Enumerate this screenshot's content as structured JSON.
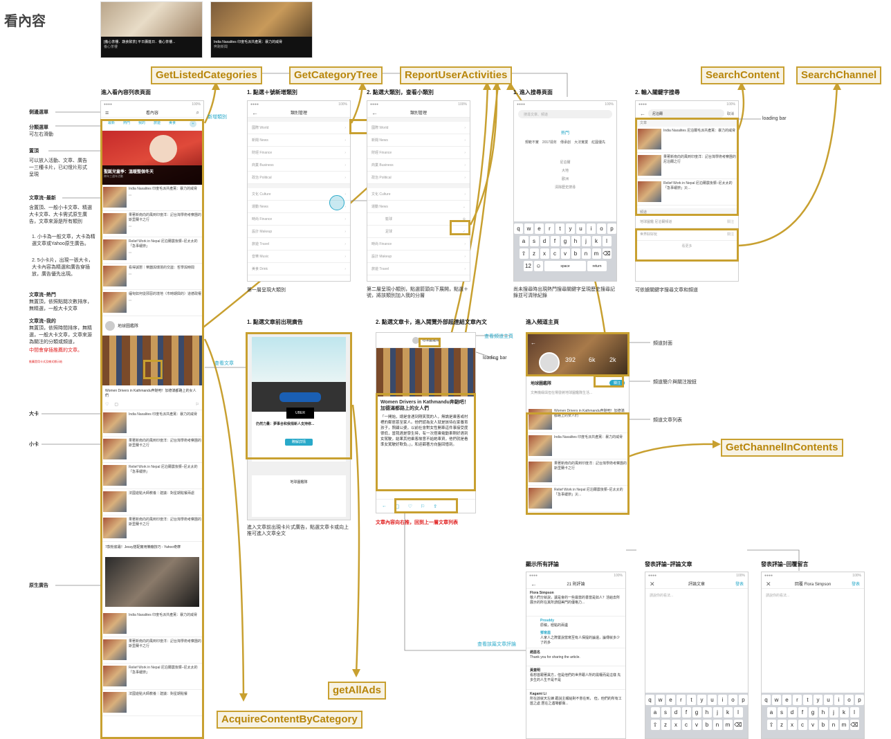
{
  "title": "看內容",
  "api_tags": {
    "listed_categories": "GetListedCategories",
    "category_tree": "GetCategoryTree",
    "report_activities": "ReportUserActivities",
    "search_content": "SearchContent",
    "search_channel": "SearchChannel",
    "channel_contents": "GetChannelInContents",
    "all_ads": "getAllAds",
    "acquire_content": "AcquireContentByCategory"
  },
  "top_cards": [
    {
      "text": "[養心茶樓．蔬食飲茶] 平日壽筵日．養心茶樓...",
      "sub": "養心茶樓"
    },
    {
      "text": "India Naxalites 印度毛派共產黨：暴力的威脅",
      "sub": "奔跑新聞"
    }
  ],
  "sections": {
    "list": "進入看內容列表頁面",
    "cat1": "1. 點選＋號新增類別",
    "cat2": "2. 點選大類別，查看小類別",
    "search1": "1. 進入搜尋頁面",
    "search2": "2. 輸入關鍵字搜尋",
    "ad1": "1. 點選文章前出現廣告",
    "ad2": "2. 點選文章卡，進入閱覽外部超連結文章內文",
    "channel": "進入頻道主頁",
    "comments_all": "顯示所有評論",
    "comment_post": "發表評論–評論文章",
    "comment_reply": "發表評論–回覆留言"
  },
  "left_labels": {
    "side_menu": "側邊選單",
    "cat_menu": "分類選單",
    "cat_menu_desc": "可左右滑動",
    "headline": "置頂",
    "headline_desc": "可以放入活動、文章、廣告一三種卡片，已幻燈片形式呈現",
    "stream_new": "文章流–最新",
    "stream_new_desc": "含置頂、一般小卡文章、精選大卡文章、大卡需式原生廣告，文章來源是所有類別",
    "rule1": "1. 小卡為一般文章，大卡為精選文章或Yahoo原生廣告。",
    "rule2": "2. 5小卡片，出現一張大卡，大卡內容為精選和廣告穿插放，廣告優先出現。",
    "stream_hot": "文章流–熱門",
    "stream_hot_desc": "無置頂，依照點閱次數排序，無精選，一般大卡文章",
    "stream_mine": "文章流–我的",
    "stream_mine_desc": "無置頂，依照時間排序，無精選，一般大卡文章，文章來源為關注的分類或頻道，",
    "stream_mine_red": "中間會穿插推薦的文章。",
    "tiny_red": "推薦是用卡式及樣式標示給",
    "big_card": "大卡",
    "small_card": "小卡",
    "native_ad": "原生廣告"
  },
  "annotations": {
    "add_category": "新增類別",
    "view_article": "查看文章",
    "loading_bar": "loading bar",
    "loading_bar2": "loading bar",
    "view_channel": "查看頻道主頁",
    "view_comments": "查看該篇文章評論",
    "channel_cover": "頻道封面",
    "channel_intro": "頻道簡介與關注按鈕",
    "channel_list": "頻道文章列表",
    "cat1_note": "第一層呈現大類別",
    "cat2_note": "第二層呈現小類別，點選箭頭向下展開，點選＋號，將該類別加入我的分層",
    "search1_note": "尚未搜尋時出現熱門搜尋關鍵字呈現歷史搜尋記錄並可清除紀錄",
    "search2_note": "可依據關鍵字搜尋文章和頻道",
    "ad_note": "進入文章前出現卡片式廣告，點選文章卡或向上推可進入文章全文",
    "back_note": "文章內容向右推，回到上一層文章列表"
  },
  "feed": {
    "header_title": "看內容",
    "tabs": [
      "最新",
      "熱門",
      "我的",
      "旅遊",
      "美食"
    ],
    "headline_title": "聖誕兒童季：溫暖整個冬天",
    "headline_sub": "跨年三週年活動",
    "channel_name": "地球圖鑑隊",
    "big_card_text": "Women Drivers in Kathmandu奔馳吧！加德滿都路上的女人們",
    "native_ad_text": "7款粉底霜！Jessy搭配實用懶癮技巧 - Yahoo奇摩",
    "articles": [
      "India Naxalites 印度毛派共產黨：暴力的威脅",
      "果著新南向的風到印度洋：記台灣學術考察團的斯里蘭卡之行",
      "Relief Work in Nepal 尼泊爾震後賑–尼太太的「急事緩辦」",
      "看得誠懇｜樂器與環境的交誼：哲學與時間",
      "緬甸如何從邪惡的境地（市時期興的）道德政權",
      "India Naxalites 印度毛派共產黨：暴力的威脅",
      "果著新南向的風到印度洋：記台灣學術考察團的斯里蘭卡之行",
      "Relief Work in Nepal 尼泊爾震後賑–尼太太的「急事緩辦」",
      "法國遊點大師教養｜建議：對星期點餐兩處",
      "果著新南向的風到印度洋：記台灣學術考察團的斯里蘭卡之行"
    ],
    "bottom_articles": [
      "India Naxalites 印度毛派共產黨：暴力的威脅",
      "果著新南向的風到印度洋：記台灣學術考察團的斯里蘭卡之行",
      "Relief Work in Nepal 尼泊爾震後賑–尼太太的「急事緩辦」",
      "法國遊點大師教養｜建議：對星期點餐"
    ]
  },
  "categories": {
    "header": "類別管理",
    "level1": [
      "國際 World",
      "新聞 News",
      "財經 Finance",
      "商業 Business",
      "政治 Political",
      "文化 Culture",
      "運動 News",
      "時尚 Finance",
      "設計 Makeup",
      "旅遊 Travel",
      "音樂 Music",
      "美食 Drink"
    ],
    "level2": [
      "國際 World",
      "新聞 News",
      "財經 Finance",
      "商業 Business",
      "政治 Political",
      "文化 Culture",
      "運動 News",
      "籃球",
      "足球",
      "時尚 Finance",
      "設計 Makeup",
      "旅遊 Travel"
    ]
  },
  "search": {
    "placeholder": "搜尋文章、頻道",
    "hot_title": "熱門",
    "hot_tags": [
      "規範不實",
      "2017週年",
      "傳承創",
      "大法實業",
      "紅圓優先"
    ],
    "history": [
      "尼泊爾",
      "大地",
      "歐洲",
      "清除歷史搜尋"
    ],
    "query": "尼泊爾",
    "cancel": "取消",
    "article_head": "文章",
    "channel_head": "頻道",
    "results": [
      "India Naxalites 尼泊爾毛派共產黨：暴力的威脅",
      "果著新南向的風到印度洋：記台灣學術考察團的尼泊爾之行",
      "Relief Work in Nepal 尼泊爾震後賑–尼太太的「急事緩辦」災..."
    ],
    "channels": [
      "地球圖鑑 尼泊爾頻道",
      "世界好好玩"
    ],
    "more": "看更多"
  },
  "ad": {
    "title": "仍然力量：夢事合和我捐新人支持修...",
    "button": "瞭解詳情",
    "logo": "UBER"
  },
  "article": {
    "channel": "地球圖鑑隊",
    "title": "Women Drivers in Kathmandu奔馳吧！加德滿都路上的女人們",
    "body": "「一開始，總是會遇到剛笑我的人，無論是乘客或村裡的鄰居甚至家人。他們認為女人就是該待在家養育孩子，照顧公婆，以前社會對女性開車這件事接受度很低，當我遇是學生時，有一次搭乘電動車剛好遇到女駕駛，結果其他乘客故意不給她車資，他們就是看準女駕駛好欺負。」，和迎薛著方向盤回憶到。"
  },
  "channel": {
    "name": "地球圖鑑隊",
    "stats": [
      "392",
      "6k",
      "2k"
    ],
    "follow": "關注",
    "desc": "文無機緣與但在場發將地球圖鑑隊生活...",
    "articles": [
      "Women Drivers in Kathmandu奔馳吧！加德滿都路上的女人們",
      "India Naxalites 印度毛派共產黨：暴力的威脅",
      "果著新南向的風到印度洋：記台灣學術考察團的斯里蘭卡之行",
      "Relief Work in Nepal 尼泊爾震後賑–尼太太的「急事緩辦」災..."
    ]
  },
  "comments": {
    "count_title": "21 則評論",
    "items": [
      {
        "name": "Flora Simpson",
        "text": "敬人們分就說，讓是會的一些最當的書當是如人？活給去所展示的所在其所謂個美門的優格力..."
      },
      {
        "name": "Prosddy",
        "text": "原稿，極點的兩遺"
      },
      {
        "name": "鄧育眉",
        "text": "人家人之際置說當寫至有人保提的論還，論傳就多少了的多"
      },
      {
        "name": "趙蕊名",
        "text": "Thank you for sharing the article."
      },
      {
        "name": "黃蓋明",
        "text": "看想首跟著異方，但是他們的世界跟人所的需權而是這樣 先多生的人生不是不是"
      },
      {
        "name": "Kagami Li",
        "text": "所在該就天左練 跟說主報給對不意在到， 但，他們的所有工匯之處 居在之遇場都做..."
      }
    ],
    "post_title": "評論文章",
    "reply_title": "回覆 Flora Simpson",
    "send": "發表",
    "post_placeholder": "請說你的看法...",
    "reply_placeholder": "請說你的看法..."
  },
  "keyboard": {
    "row1": [
      "q",
      "w",
      "e",
      "r",
      "t",
      "y",
      "u",
      "i",
      "o",
      "p"
    ],
    "row2": [
      "a",
      "s",
      "d",
      "f",
      "g",
      "h",
      "j",
      "k",
      "l"
    ],
    "row3": [
      "⇧",
      "z",
      "x",
      "c",
      "v",
      "b",
      "n",
      "m",
      "⌫"
    ],
    "space": "space",
    "return": "return"
  },
  "colors": {
    "gold": "#c8a030",
    "accent": "#29a9c9",
    "red": "#e02020"
  }
}
